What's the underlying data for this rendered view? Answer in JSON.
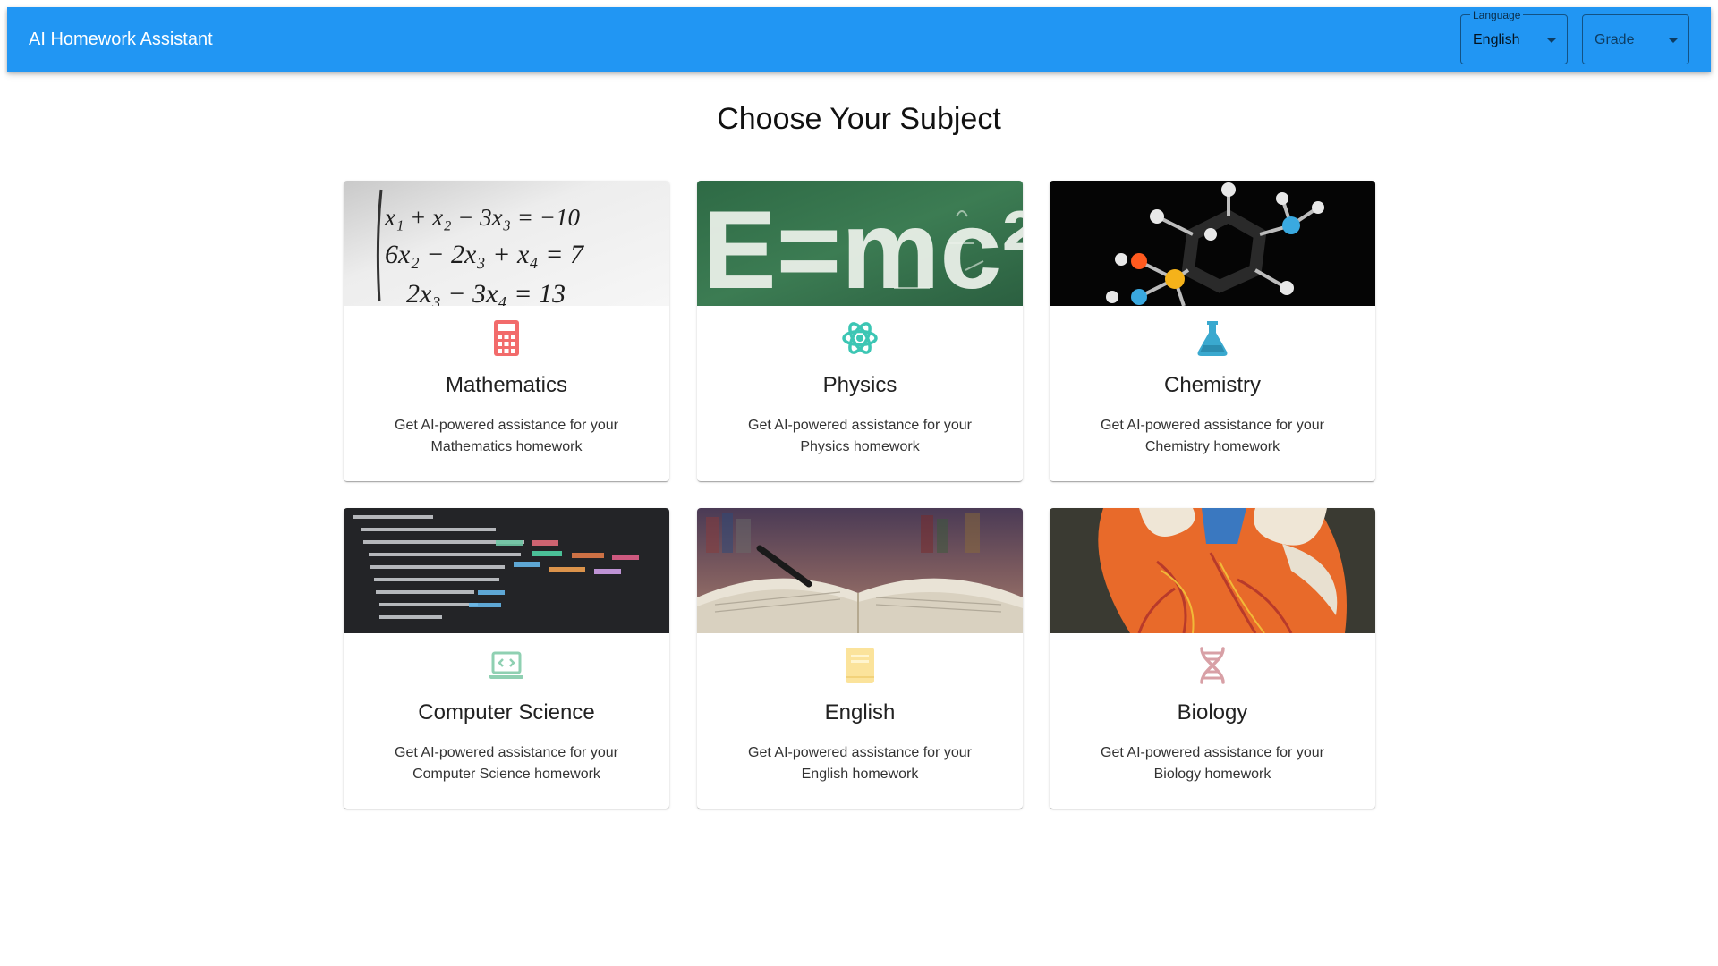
{
  "app": {
    "title": "AI Homework Assistant"
  },
  "header": {
    "language": {
      "label": "Language",
      "value": "English"
    },
    "grade": {
      "placeholder": "Grade"
    }
  },
  "main": {
    "title": "Choose Your Subject",
    "subjects": [
      {
        "name": "Mathematics",
        "description": "Get AI-powered assistance for your Mathematics homework",
        "icon": "calculator-icon",
        "color": "#f26b6b"
      },
      {
        "name": "Physics",
        "description": "Get AI-powered assistance for your Physics homework",
        "icon": "atom-icon",
        "color": "#3cc6b4"
      },
      {
        "name": "Chemistry",
        "description": "Get AI-powered assistance for your Chemistry homework",
        "icon": "flask-icon",
        "color": "#3aa9cf"
      },
      {
        "name": "Computer Science",
        "description": "Get AI-powered assistance for your Computer Science homework",
        "icon": "laptop-code-icon",
        "color": "#8fd0b2"
      },
      {
        "name": "English",
        "description": "Get AI-powered assistance for your English homework",
        "icon": "book-icon",
        "color": "#fbe39b"
      },
      {
        "name": "Biology",
        "description": "Get AI-powered assistance for your Biology homework",
        "icon": "dna-icon",
        "color": "#d8a0a6"
      }
    ],
    "image_text": {
      "math": {
        "line1": "x₁ + x₂ − 3x₃ = −10",
        "line2": "6x₂ − 2x₃ + x₄ = 7",
        "line3": "2x₃ − 3x₄ = 13"
      },
      "physics": {
        "formula": "E=mc²"
      }
    }
  },
  "theme": {
    "primary": "#2196f3"
  }
}
